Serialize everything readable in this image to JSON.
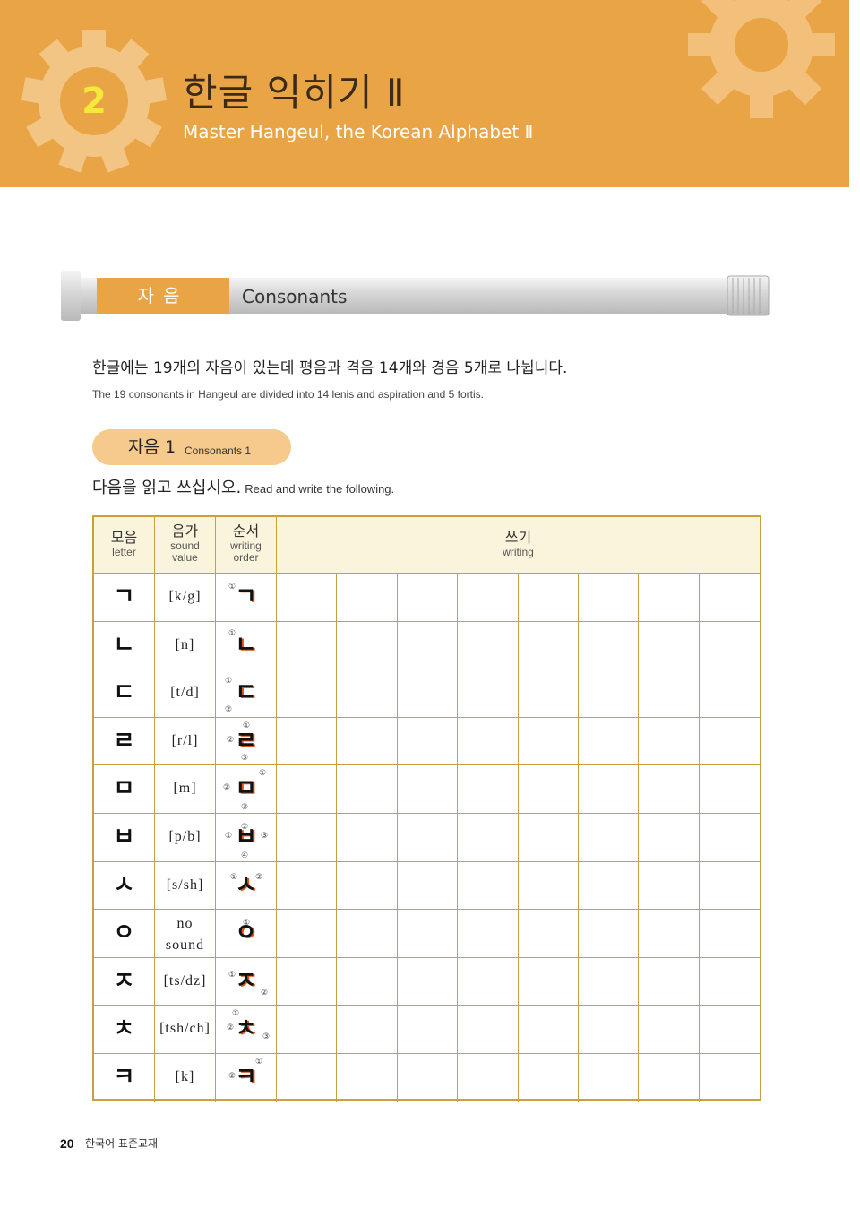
{
  "header": {
    "lesson_number": "2",
    "title_ko": "한글 익히기 Ⅱ",
    "title_en": "Master Hangeul, the Korean Alphabet Ⅱ"
  },
  "section": {
    "label_ko": "자음",
    "label_en": "Consonants"
  },
  "intro": {
    "ko": "한글에는 19개의 자음이 있는데 평음과 격음 14개와 경음 5개로 나뉩니다.",
    "en": "The 19 consonants in Hangeul are divided into 14 lenis and aspiration and 5 fortis."
  },
  "subsection": {
    "label_ko": "자음 1",
    "label_en": "Consonants 1"
  },
  "instruction": {
    "ko": "다음을 읽고 쓰십시오.",
    "en": "Read and write the following."
  },
  "table": {
    "headers": {
      "letter": {
        "ko": "모음",
        "en": "letter"
      },
      "sound": {
        "ko": "음가",
        "en1": "sound",
        "en2": "value"
      },
      "order": {
        "ko": "순서",
        "en1": "writing",
        "en2": "order"
      },
      "writing": {
        "ko": "쓰기",
        "en": "writing"
      }
    },
    "rows": [
      {
        "letter": "ㄱ",
        "sound": "[k/g]",
        "marks": [
          "①"
        ]
      },
      {
        "letter": "ㄴ",
        "sound": "[n]",
        "marks": [
          "①"
        ]
      },
      {
        "letter": "ㄷ",
        "sound": "[t/d]",
        "marks": [
          "①",
          "②"
        ]
      },
      {
        "letter": "ㄹ",
        "sound": "[r/l]",
        "marks": [
          "①",
          "②",
          "③"
        ]
      },
      {
        "letter": "ㅁ",
        "sound": "[m]",
        "marks": [
          "①",
          "②",
          "③"
        ]
      },
      {
        "letter": "ㅂ",
        "sound": "[p/b]",
        "marks": [
          "①",
          "②",
          "③",
          "④"
        ]
      },
      {
        "letter": "ㅅ",
        "sound": "[s/sh]",
        "marks": [
          "①",
          "②"
        ]
      },
      {
        "letter": "ㅇ",
        "sound": "no sound",
        "sound_line1": "no",
        "sound_line2": "sound",
        "marks": [
          "①"
        ]
      },
      {
        "letter": "ㅈ",
        "sound": "[ts/dz]",
        "marks": [
          "①",
          "②"
        ]
      },
      {
        "letter": "ㅊ",
        "sound": "[tsh/ch]",
        "marks": [
          "①",
          "②",
          "③"
        ]
      },
      {
        "letter": "ㅋ",
        "sound": "[k]",
        "marks": [
          "①",
          "②"
        ]
      }
    ]
  },
  "footer": {
    "page_number": "20",
    "book_title": "한국어 표준교재"
  },
  "colors": {
    "header_orange": "#e9a545",
    "lesson_number_yellow": "#f6e93a",
    "table_border": "#c9a03d",
    "stroke_arrow": "#d9531e",
    "pill": "#f6c98c"
  }
}
